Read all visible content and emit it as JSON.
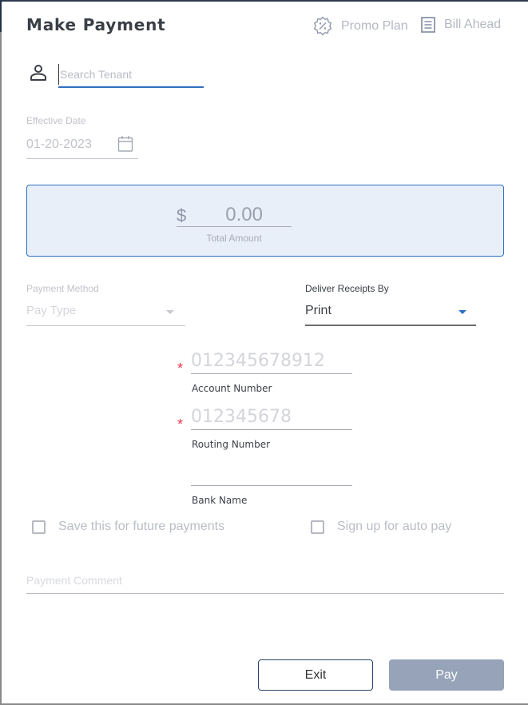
{
  "dialog": {
    "title": "Make Payment"
  },
  "header_actions": {
    "promo_plan": {
      "label": "Promo Plan",
      "icon": "percent-badge-icon"
    },
    "bill_ahead": {
      "label": "Bill Ahead",
      "icon": "receipt-list-icon"
    }
  },
  "tenant_search": {
    "icon": "person-icon",
    "value": "",
    "placeholder": "Search Tenant"
  },
  "effective_date": {
    "label": "Effective Date",
    "value": "01-20-2023",
    "icon": "calendar-icon"
  },
  "total": {
    "currency_symbol": "$",
    "amount": "0.00",
    "label": "Total Amount"
  },
  "payment_method": {
    "label": "Payment Method",
    "selected": "Pay Type"
  },
  "deliver_receipts": {
    "label": "Deliver Receipts By",
    "selected": "Print"
  },
  "bank": {
    "account_number": {
      "placeholder": "012345678912",
      "label": "Account Number",
      "required": "*"
    },
    "routing_number": {
      "placeholder": "012345678",
      "label": "Routing Number",
      "required": "*"
    },
    "bank_name": {
      "placeholder": "",
      "label": "Bank Name"
    }
  },
  "options": {
    "save_future": {
      "label": "Save this for future payments",
      "checked": false
    },
    "auto_pay": {
      "label": "Sign up for auto pay",
      "checked": false
    }
  },
  "comment": {
    "placeholder": "Payment Comment",
    "value": ""
  },
  "buttons": {
    "exit": "Exit",
    "pay": "Pay"
  },
  "colors": {
    "accent": "#2e6fc2",
    "required": "#e8394d",
    "pay_disabled": "#96a3b9",
    "amount_bg": "#e8eff9"
  }
}
